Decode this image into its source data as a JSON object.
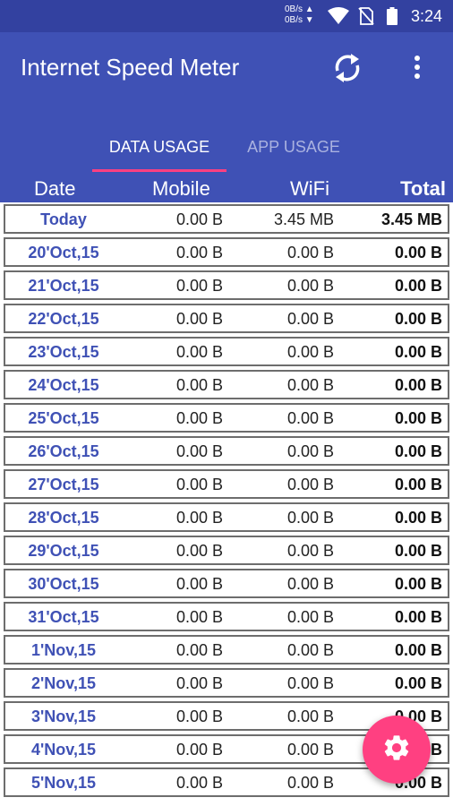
{
  "status_bar": {
    "upload_speed": "0B/s ▲",
    "download_speed": "0B/s ▼",
    "time": "3:24",
    "icons": [
      "wifi-icon",
      "no-sim-icon",
      "battery-icon"
    ]
  },
  "app_bar": {
    "title": "Internet Speed Meter",
    "actions": [
      "refresh-icon",
      "more-vert-icon"
    ]
  },
  "tabs": [
    {
      "label": "DATA USAGE",
      "selected": true
    },
    {
      "label": "APP USAGE",
      "selected": false
    }
  ],
  "table": {
    "headers": {
      "date": "Date",
      "mobile": "Mobile",
      "wifi": "WiFi",
      "total": "Total"
    },
    "rows": [
      {
        "date": "Today",
        "mobile": "0.00 B",
        "wifi": "3.45 MB",
        "total": "3.45 MB"
      },
      {
        "date": "20'Oct,15",
        "mobile": "0.00 B",
        "wifi": "0.00 B",
        "total": "0.00 B"
      },
      {
        "date": "21'Oct,15",
        "mobile": "0.00 B",
        "wifi": "0.00 B",
        "total": "0.00 B"
      },
      {
        "date": "22'Oct,15",
        "mobile": "0.00 B",
        "wifi": "0.00 B",
        "total": "0.00 B"
      },
      {
        "date": "23'Oct,15",
        "mobile": "0.00 B",
        "wifi": "0.00 B",
        "total": "0.00 B"
      },
      {
        "date": "24'Oct,15",
        "mobile": "0.00 B",
        "wifi": "0.00 B",
        "total": "0.00 B"
      },
      {
        "date": "25'Oct,15",
        "mobile": "0.00 B",
        "wifi": "0.00 B",
        "total": "0.00 B"
      },
      {
        "date": "26'Oct,15",
        "mobile": "0.00 B",
        "wifi": "0.00 B",
        "total": "0.00 B"
      },
      {
        "date": "27'Oct,15",
        "mobile": "0.00 B",
        "wifi": "0.00 B",
        "total": "0.00 B"
      },
      {
        "date": "28'Oct,15",
        "mobile": "0.00 B",
        "wifi": "0.00 B",
        "total": "0.00 B"
      },
      {
        "date": "29'Oct,15",
        "mobile": "0.00 B",
        "wifi": "0.00 B",
        "total": "0.00 B"
      },
      {
        "date": "30'Oct,15",
        "mobile": "0.00 B",
        "wifi": "0.00 B",
        "total": "0.00 B"
      },
      {
        "date": "31'Oct,15",
        "mobile": "0.00 B",
        "wifi": "0.00 B",
        "total": "0.00 B"
      },
      {
        "date": "1'Nov,15",
        "mobile": "0.00 B",
        "wifi": "0.00 B",
        "total": "0.00 B"
      },
      {
        "date": "2'Nov,15",
        "mobile": "0.00 B",
        "wifi": "0.00 B",
        "total": "0.00 B"
      },
      {
        "date": "3'Nov,15",
        "mobile": "0.00 B",
        "wifi": "0.00 B",
        "total": "0.00 B"
      },
      {
        "date": "4'Nov,15",
        "mobile": "0.00 B",
        "wifi": "0.00 B",
        "total": "0.00 B"
      },
      {
        "date": "5'Nov,15",
        "mobile": "0.00 B",
        "wifi": "0.00 B",
        "total": "0.00 B"
      }
    ]
  },
  "fab": {
    "icon": "settings-icon"
  },
  "colors": {
    "primary": "#3f51b5",
    "primary_dark": "#3341a0",
    "accent": "#ff4081",
    "date_text": "#3f51b5"
  }
}
